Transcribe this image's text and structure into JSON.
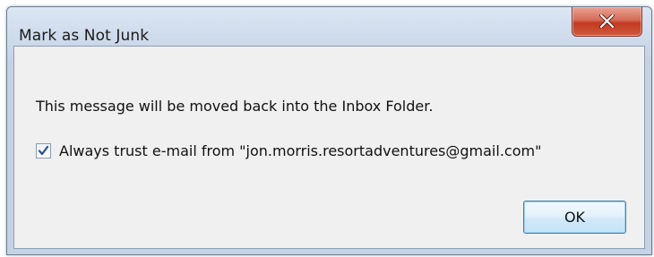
{
  "window": {
    "title": "Mark as Not Junk",
    "close_icon": "close-icon",
    "close_button_color": "#c23a22"
  },
  "dialog": {
    "message": "This message will be moved back into the Inbox Folder.",
    "trust_checkbox": {
      "label": "Always trust e-mail from \"jon.morris.resortadventures@gmail.com\"",
      "checked": true,
      "check_icon": "checkmark-icon",
      "check_color": "#2c4f8f"
    },
    "ok_label": "OK"
  }
}
